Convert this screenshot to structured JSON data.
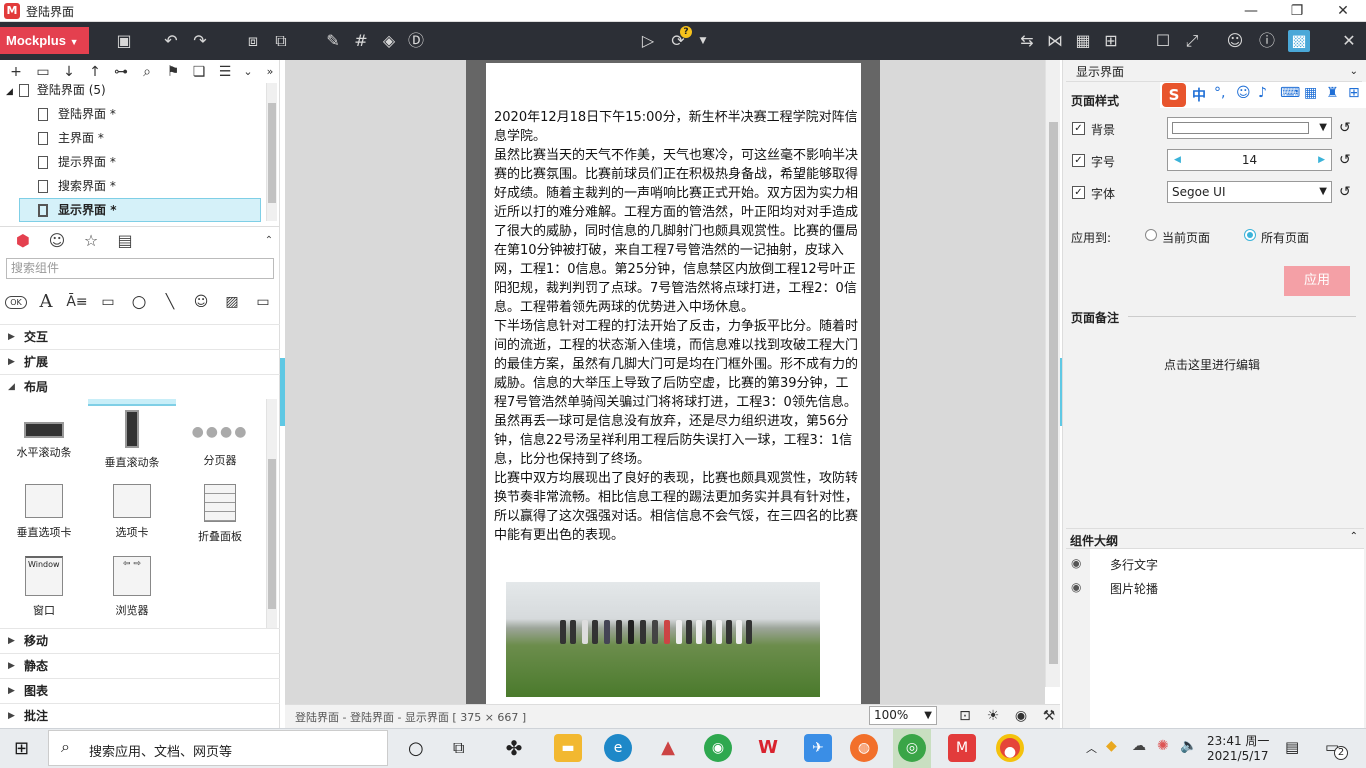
{
  "window": {
    "title": "登陆界面",
    "app_logo_text": "M"
  },
  "toolbar": {
    "brand": "Mockplus",
    "help_badge": "?"
  },
  "project": {
    "root": "登陆界面 (5)",
    "pages": [
      {
        "label": "登陆界面",
        "mark": "*"
      },
      {
        "label": "主界面",
        "mark": "*"
      },
      {
        "label": "提示界面",
        "mark": "*"
      },
      {
        "label": "搜索界面",
        "mark": "*"
      },
      {
        "label": "显示界面",
        "mark": "*"
      }
    ]
  },
  "components": {
    "search_placeholder": "搜索组件",
    "categories_top": [
      "交互",
      "扩展",
      "布局"
    ],
    "layout_widgets": [
      "水平滚动条",
      "垂直滚动条",
      "分页器",
      "垂直选项卡",
      "选项卡",
      "折叠面板",
      "窗口",
      "浏览器"
    ],
    "window_widget_text": "Window",
    "categories_bottom": [
      "移动",
      "静态",
      "图表",
      "批注"
    ],
    "palette_ok": "OK"
  },
  "article": {
    "paragraphs": [
      "2020年12月18日下午15:00分，新生杯半决赛工程学院对阵信息学院。",
      "虽然比赛当天的天气不作美，天气也寒冷，可这丝毫不影响半决赛的比赛氛围。比赛前球员们正在积极热身备战，希望能够取得好成绩。随着主裁判的一声哨响比赛正式开始。双方因为实力相近所以打的难分难解。工程方面的管浩然，叶正阳均对对手造成了很大的威胁，同时信息的几脚射门也颇具观赏性。比赛的僵局在第10分钟被打破，来自工程7号管浩然的一记抽射，皮球入网，工程1：0信息。第25分钟，信息禁区内放倒工程12号叶正阳犯规，裁判判罚了点球。7号管浩然将点球打进，工程2：0信息。工程带着领先两球的优势进入中场休息。",
      "下半场信息针对工程的打法开始了反击，力争扳平比分。随着时间的流逝，工程的状态渐入佳境，而信息难以找到攻破工程大门的最佳方案，虽然有几脚大门可是均在门框外围。形不成有力的威胁。信息的大举压上导致了后防空虚，比赛的第39分钟，工程7号管浩然单骑闯关骗过门将将球打进，工程3：0领先信息。虽然再丢一球可是信息没有放弃，还是尽力组织进攻，第56分钟，信息22号汤呈祥利用工程后防失误打入一球，工程3：1信息，比分也保持到了终场。",
      "比赛中双方均展现出了良好的表现，比赛也颇具观赏性，攻防转换节奏非常流畅。相比信息工程的踢法更加务实并具有针对性，所以赢得了这次强强对话。相信信息不会气馁，在三四名的比赛中能有更出色的表现。"
    ]
  },
  "status": {
    "breadcrumb": "登陆界面 - 登陆界面 - 显示界面 [ 375 × 667 ]",
    "zoom": "100%"
  },
  "right": {
    "panel_title": "显示界面",
    "page_style": "页面样式",
    "bg_label": "背景",
    "font_size_label": "字号",
    "font_size_value": "14",
    "font_label": "字体",
    "font_value": "Segoe UI",
    "apply_to": "应用到:",
    "current_page": "当前页面",
    "all_pages": "所有页面",
    "apply_btn": "应用",
    "notes_title": "页面备注",
    "notes_placeholder": "点击这里进行编辑",
    "outline_title": "组件大纲",
    "outline_items": [
      "多行文字",
      "图片轮播"
    ],
    "ime_zh": "中"
  },
  "taskbar": {
    "search_text": "搜索应用、文档、网页等",
    "time": "23:41 周一",
    "date": "2021/5/17",
    "notif_count": "2"
  },
  "colors": {
    "brand": "#e4404f",
    "toolbar_bg": "#2c2f36",
    "selection": "#d5f1f9",
    "apply_btn": "#f4a0a6"
  }
}
